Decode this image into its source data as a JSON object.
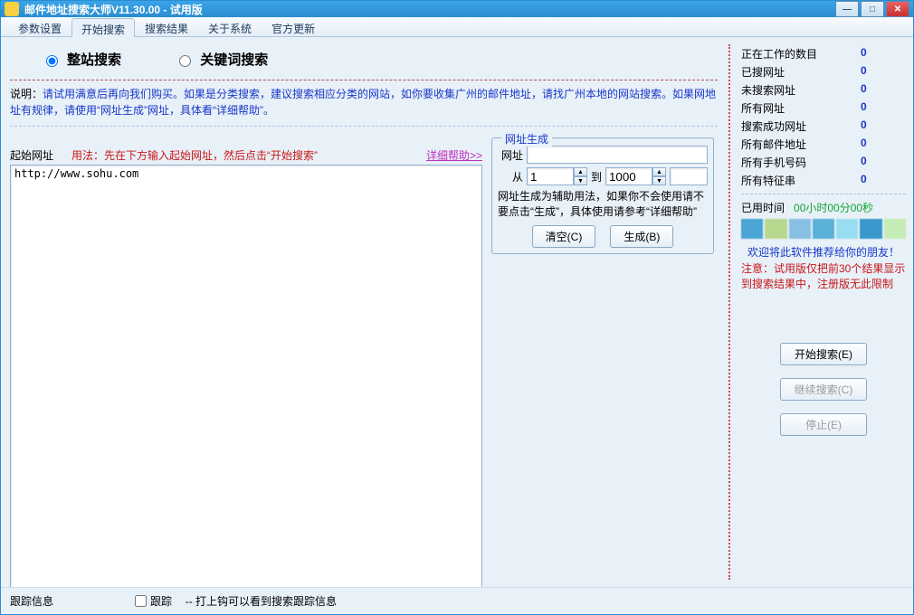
{
  "title": "邮件地址搜索大师V11.30.00 - 试用版",
  "tabs": [
    "参数设置",
    "开始搜索",
    "搜索结果",
    "关于系统",
    "官方更新"
  ],
  "active_tab": 1,
  "radios": {
    "whole_site": "整站搜索",
    "keyword": "关键词搜索"
  },
  "explain_label": "说明：",
  "explain_text": "请试用满意后再向我们购买。如果是分类搜索，建议搜索相应分类的网站，如你要收集广州的邮件地址，请找广州本地的网站搜索。如果网地址有规律，请使用“网址生成”网址，具体看“详细帮助”。",
  "start_url_label": "起始网址",
  "usage": "用法：先在下方输入起始网址，然后点击“开始搜索”",
  "help_link": "详细帮助>>",
  "urls_value": "http://www.sohu.com",
  "gen": {
    "legend": "网址生成",
    "url_label": "网址",
    "from_label": "从",
    "to_label": "到",
    "from_val": "1",
    "to_val": "1000",
    "note": "网址生成为辅助用法，如果你不会使用请不要点击“生成”，具体使用请参考“详细帮助”",
    "clear_btn": "清空(C)",
    "gen_btn": "生成(B)"
  },
  "stats": [
    {
      "label": "正在工作的数目",
      "val": "0"
    },
    {
      "label": "已搜网址",
      "val": "0"
    },
    {
      "label": "未搜索网址",
      "val": "0"
    },
    {
      "label": "所有网址",
      "val": "0"
    },
    {
      "label": "搜索成功网址",
      "val": "0"
    },
    {
      "label": "所有邮件地址",
      "val": "0"
    },
    {
      "label": "所有手机号码",
      "val": "0"
    },
    {
      "label": "所有特征串",
      "val": "0"
    }
  ],
  "elapsed_label": "已用时间",
  "elapsed_val": "00小时00分00秒",
  "recommend": "欢迎将此软件推荐给你的朋友！",
  "trial_note": "注意：试用版仅把前30个结果显示到搜索结果中，注册版无此限制",
  "side_btns": {
    "start": "开始搜索(E)",
    "cont": "继续搜索(C)",
    "stop": "停止(E)"
  },
  "track": {
    "label": "跟踪信息",
    "cb": "跟踪",
    "note": "-- 打上钩可以看到搜索跟踪信息"
  }
}
